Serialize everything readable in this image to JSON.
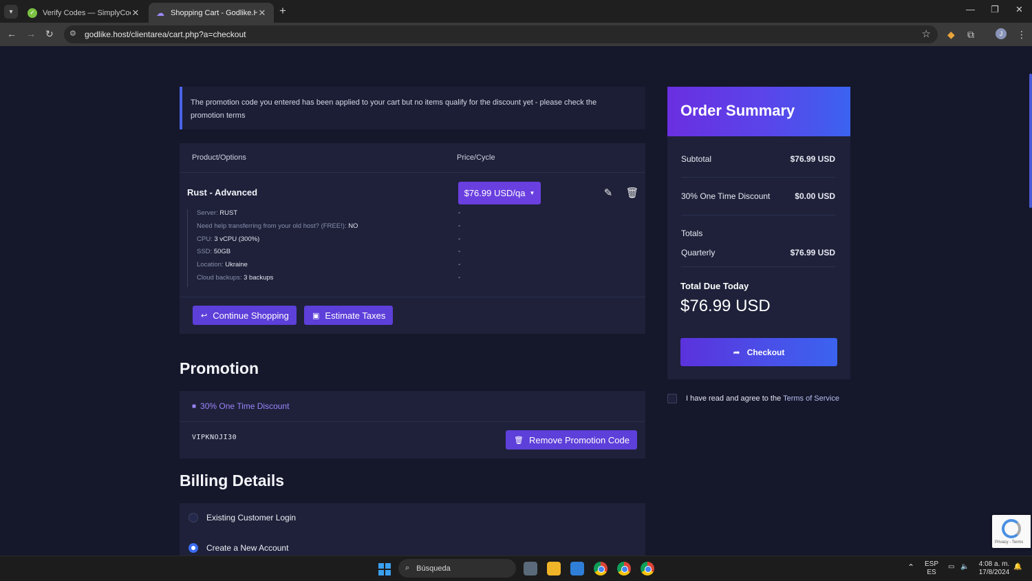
{
  "browser": {
    "tabs": [
      {
        "title": "Verify Codes — SimplyCodes",
        "active": false
      },
      {
        "title": "Shopping Cart - Godlike.Host",
        "active": true
      }
    ],
    "url": "godlike.host/clientarea/cart.php?a=checkout",
    "profile_initial": "J"
  },
  "alert": {
    "text": "The promotion code you entered has been applied to your cart but no items qualify for the discount yet - please check the promotion terms"
  },
  "cart": {
    "col_product": "Product/Options",
    "col_price": "Price/Cycle",
    "product_name": "Rust - Advanced",
    "price": "$76.99 USD/qa",
    "options": [
      {
        "label": "Server:",
        "value": "RUST",
        "price": "-"
      },
      {
        "label": "Need help transferring from your old host? (FREE!):",
        "value": "NO",
        "price": "-"
      },
      {
        "label": "CPU:",
        "value": "3 vCPU (300%)",
        "price": "-"
      },
      {
        "label": "SSD:",
        "value": "50GB",
        "price": "-"
      },
      {
        "label": "Location:",
        "value": "Ukraine",
        "price": "-"
      },
      {
        "label": "Cloud backups:",
        "value": "3 backups",
        "price": "-"
      }
    ],
    "continue_label": "Continue Shopping",
    "estimate_label": "Estimate Taxes"
  },
  "promotion": {
    "heading": "Promotion",
    "title": "30% One Time Discount",
    "code": "VIPKNOJI30",
    "remove_label": "Remove Promotion Code"
  },
  "billing": {
    "heading": "Billing Details",
    "options": [
      {
        "label": "Existing Customer Login",
        "selected": false
      },
      {
        "label": "Create a New Account",
        "selected": true
      }
    ]
  },
  "summary": {
    "title": "Order Summary",
    "subtotal_label": "Subtotal",
    "subtotal_value": "$76.99 USD",
    "discount_label": "30% One Time Discount",
    "discount_value": "$0.00 USD",
    "totals_label": "Totals",
    "cycle_label": "Quarterly",
    "cycle_value": "$76.99 USD",
    "due_label": "Total Due Today",
    "due_amount": "$76.99 USD",
    "checkout_label": "Checkout"
  },
  "tos": {
    "prefix": "I have read and agree to the",
    "link": "Terms of Service"
  },
  "recaptcha": {
    "text": "Privacy - Terms"
  },
  "taskbar": {
    "search_placeholder": "Búsqueda",
    "lang_top": "ESP",
    "lang_bottom": "ES",
    "time": "4:08 a. m.",
    "date": "17/8/2024"
  },
  "colors": {
    "accent": "#5d3fd9",
    "summary_gradient_start": "#6a2fe0",
    "summary_gradient_end": "#3b63f0",
    "page_bg": "#15172b",
    "panel_bg": "#1e2139"
  }
}
